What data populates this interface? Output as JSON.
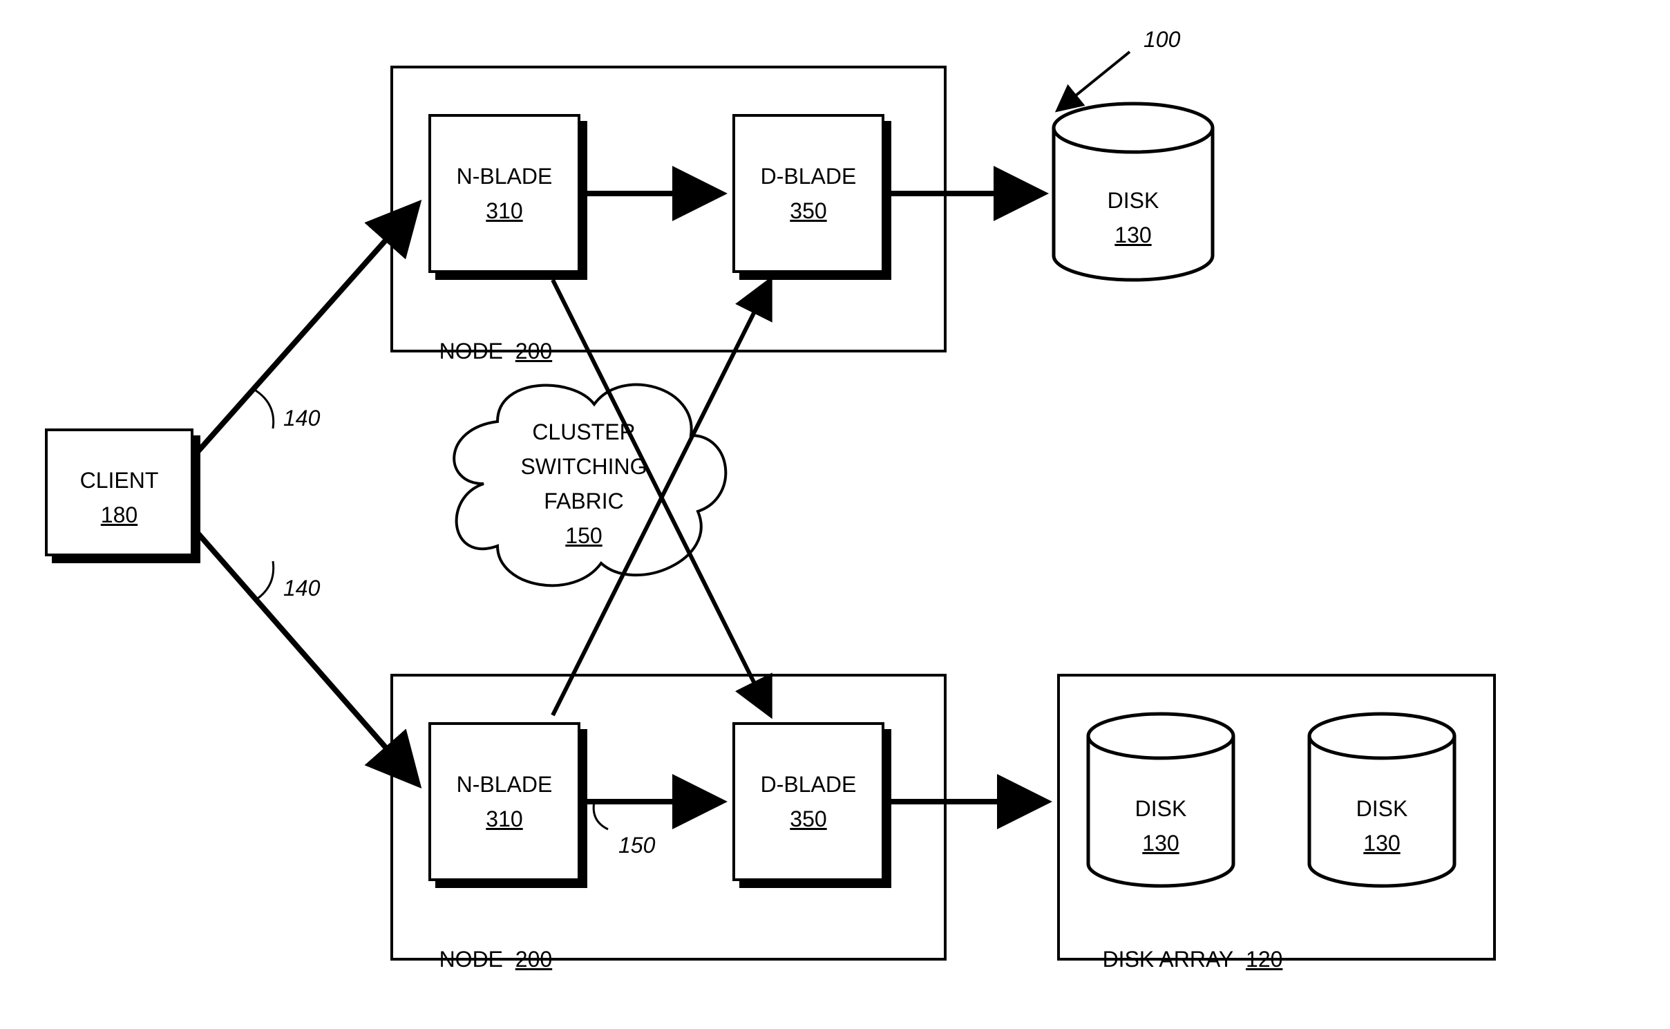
{
  "refs": {
    "system": "100",
    "client": {
      "label": "CLIENT",
      "num": "180"
    },
    "link_a": "140",
    "link_b": "140",
    "node1": {
      "label": "NODE",
      "num": "200"
    },
    "node2": {
      "label": "NODE",
      "num": "200"
    },
    "nblade1": {
      "label": "N-BLADE",
      "num": "310"
    },
    "dblade1": {
      "label": "D-BLADE",
      "num": "350"
    },
    "nblade2": {
      "label": "N-BLADE",
      "num": "310"
    },
    "dblade2": {
      "label": "D-BLADE",
      "num": "350"
    },
    "cloud": {
      "line1": "CLUSTER",
      "line2": "SWITCHING",
      "line3": "FABRIC",
      "num": "150"
    },
    "fabric_ref": "150",
    "disk_top": {
      "label": "DISK",
      "num": "130"
    },
    "disk_a": {
      "label": "DISK",
      "num": "130"
    },
    "disk_b": {
      "label": "DISK",
      "num": "130"
    },
    "disk_array": {
      "label": "DISK ARRAY",
      "num": "120"
    }
  }
}
